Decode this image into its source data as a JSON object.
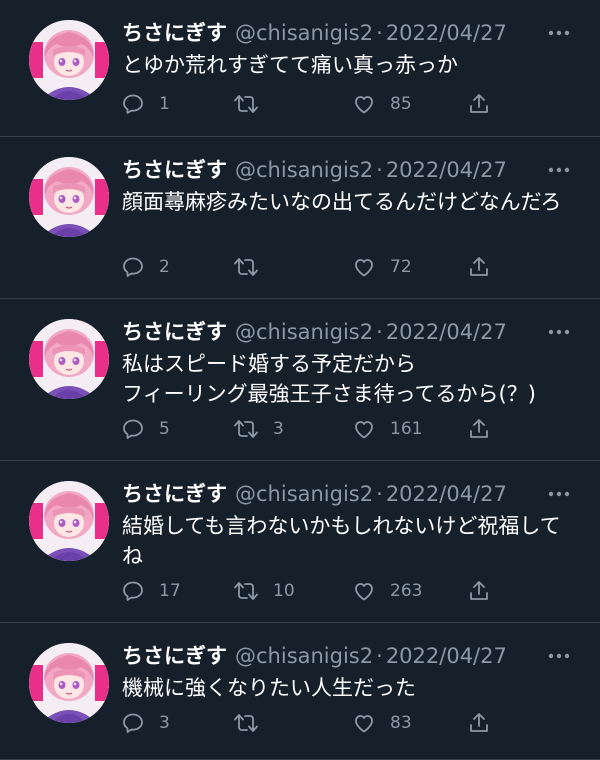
{
  "colors": {
    "background": "#15202b",
    "divider": "#38444d",
    "primary_text": "#ffffff",
    "secondary_text": "#8b98a5"
  },
  "tweets": [
    {
      "display_name": "ちさにぎす",
      "handle": "@chisanigis2",
      "separator": "·",
      "date": "2022/04/27",
      "text": "とゆか荒れすぎてて痛い真っ赤っか",
      "reply_count": "1",
      "retweet_count": "",
      "like_count": "85"
    },
    {
      "display_name": "ちさにぎす",
      "handle": "@chisanigis2",
      "separator": "·",
      "date": "2022/04/27",
      "text": "顔面蕁麻疹みたいなの出てるんだけどなんだろ",
      "reply_count": "2",
      "retweet_count": "",
      "like_count": "72"
    },
    {
      "display_name": "ちさにぎす",
      "handle": "@chisanigis2",
      "separator": "·",
      "date": "2022/04/27",
      "text": "私はスピード婚する予定だから\nフィーリング最強王子さま待ってるから(？)",
      "reply_count": "5",
      "retweet_count": "3",
      "like_count": "161"
    },
    {
      "display_name": "ちさにぎす",
      "handle": "@chisanigis2",
      "separator": "·",
      "date": "2022/04/27",
      "text": "結婚しても言わないかもしれないけど祝福してね",
      "reply_count": "17",
      "retweet_count": "10",
      "like_count": "263"
    },
    {
      "display_name": "ちさにぎす",
      "handle": "@chisanigis2",
      "separator": "·",
      "date": "2022/04/27",
      "text": "機械に強くなりたい人生だった",
      "reply_count": "3",
      "retweet_count": "",
      "like_count": "83"
    }
  ]
}
